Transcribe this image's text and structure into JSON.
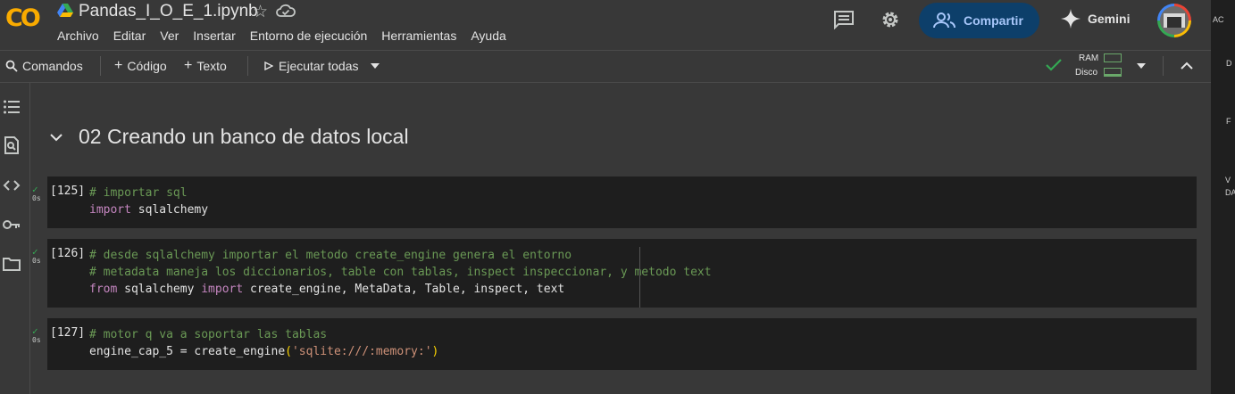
{
  "app": {
    "logo_text": "CO",
    "notebook_title": "Pandas_I_O_E_1.ipynb"
  },
  "menu": [
    "Archivo",
    "Editar",
    "Ver",
    "Insertar",
    "Entorno de ejecución",
    "Herramientas",
    "Ayuda"
  ],
  "header_right": {
    "share_label": "Compartir",
    "gemini_label": "Gemini"
  },
  "toolbar": {
    "commands_label": "Comandos",
    "add_code_label": "Código",
    "add_text_label": "Texto",
    "run_all_label": "Ejecutar todas",
    "ram_label": "RAM",
    "disk_label": "Disco"
  },
  "section": {
    "title": "02 Creando un banco de datos local"
  },
  "cells": [
    {
      "prompt": "[125]",
      "status": "✓",
      "time": "0s",
      "lines": [
        [
          {
            "t": "cm",
            "v": "# importar sql"
          }
        ],
        [
          {
            "t": "kw",
            "v": "import"
          },
          {
            "t": "tx",
            "v": " sqlalchemy"
          }
        ]
      ]
    },
    {
      "prompt": "[126]",
      "status": "✓",
      "time": "0s",
      "lines": [
        [
          {
            "t": "cm",
            "v": "# desde sqlalchemy importar el metodo create_engine genera el entorno"
          }
        ],
        [
          {
            "t": "cm",
            "v": "# metadata maneja los diccionarios, table con tablas, inspect inspeccionar, y metodo text"
          }
        ],
        [
          {
            "t": "kw",
            "v": "from"
          },
          {
            "t": "tx",
            "v": " sqlalchemy "
          },
          {
            "t": "kw",
            "v": "import"
          },
          {
            "t": "tx",
            "v": " create_engine, MetaData, Table, inspect, text"
          }
        ]
      ]
    },
    {
      "prompt": "[127]",
      "status": "✓",
      "time": "0s",
      "lines": [
        [
          {
            "t": "cm",
            "v": "# motor q va a soportar las tablas"
          }
        ],
        [
          {
            "t": "tx",
            "v": "engine_cap_5 = create_engine"
          },
          {
            "t": "pn",
            "v": "("
          },
          {
            "t": "st",
            "v": "'sqlite:///:memory:'"
          },
          {
            "t": "pn",
            "v": ")"
          }
        ]
      ]
    }
  ],
  "right_strip": [
    "AC",
    "D",
    "F",
    "V",
    "DA"
  ],
  "colors": {
    "background": "#383838",
    "cell_bg": "#1e1e1e",
    "share_bg": "#0d3f6a",
    "share_text": "#a8c7fa",
    "logo": "#f9ab00",
    "comment": "#6a9955",
    "keyword": "#c586c0",
    "string": "#ce9178",
    "success": "#34a853"
  }
}
